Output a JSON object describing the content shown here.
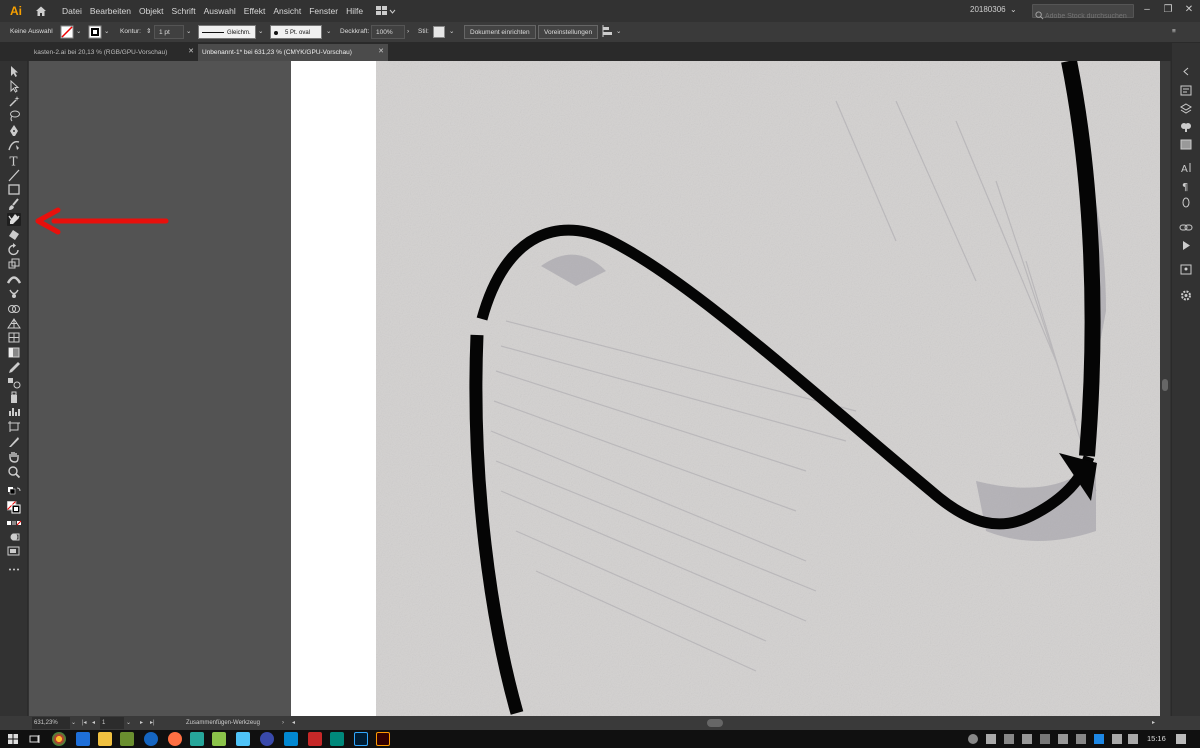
{
  "app": {
    "logo": "Ai",
    "menu": [
      "Datei",
      "Bearbeiten",
      "Objekt",
      "Schrift",
      "Auswahl",
      "Effekt",
      "Ansicht",
      "Fenster",
      "Hilfe"
    ],
    "workspace": "20180306",
    "stock_search_placeholder": "Adobe Stock durchsuchen"
  },
  "controlbar": {
    "selection": "Keine Auswahl",
    "stroke_label": "Kontur:",
    "stroke_weight": "1 pt",
    "stroke_profile": "Gleichm.",
    "brush": "5 Pt. oval",
    "opacity_label": "Deckkraft:",
    "opacity_value": "100%",
    "style_label": "Stil:",
    "doc_setup_button": "Dokument einrichten",
    "prefs_button": "Voreinstellungen"
  },
  "tabs": [
    {
      "label": "kasten-2.ai bei 20,13 % (RGB/GPU-Vorschau)",
      "active": false
    },
    {
      "label": "Unbenannt-1* bei 631,23 % (CMYK/GPU-Vorschau)",
      "active": true
    }
  ],
  "tools": [
    "selection-tool-icon",
    "direct-selection-tool-icon",
    "magic-wand-tool-icon",
    "lasso-tool-icon",
    "pen-tool-icon",
    "curvature-tool-icon",
    "type-tool-icon",
    "line-segment-tool-icon",
    "rectangle-tool-icon",
    "paintbrush-tool-icon",
    "join-tool-icon",
    "eraser-tool-icon",
    "rotate-tool-icon",
    "scale-tool-icon",
    "width-tool-icon",
    "puppet-warp-tool-icon",
    "shape-builder-tool-icon",
    "perspective-grid-tool-icon",
    "mesh-tool-icon",
    "gradient-tool-icon",
    "eyedropper-tool-icon",
    "blend-tool-icon",
    "symbol-sprayer-tool-icon",
    "column-graph-tool-icon",
    "artboard-tool-icon",
    "slice-tool-icon",
    "hand-tool-icon",
    "zoom-tool-icon"
  ],
  "active_tool": "join-tool-icon",
  "annotation_color": "#e8100c",
  "statusbar": {
    "zoom": "631,23%",
    "artboard_number": "1",
    "tool_name": "Zusammenfügen-Werkzeug"
  },
  "taskbar": {
    "time": "15:16"
  }
}
